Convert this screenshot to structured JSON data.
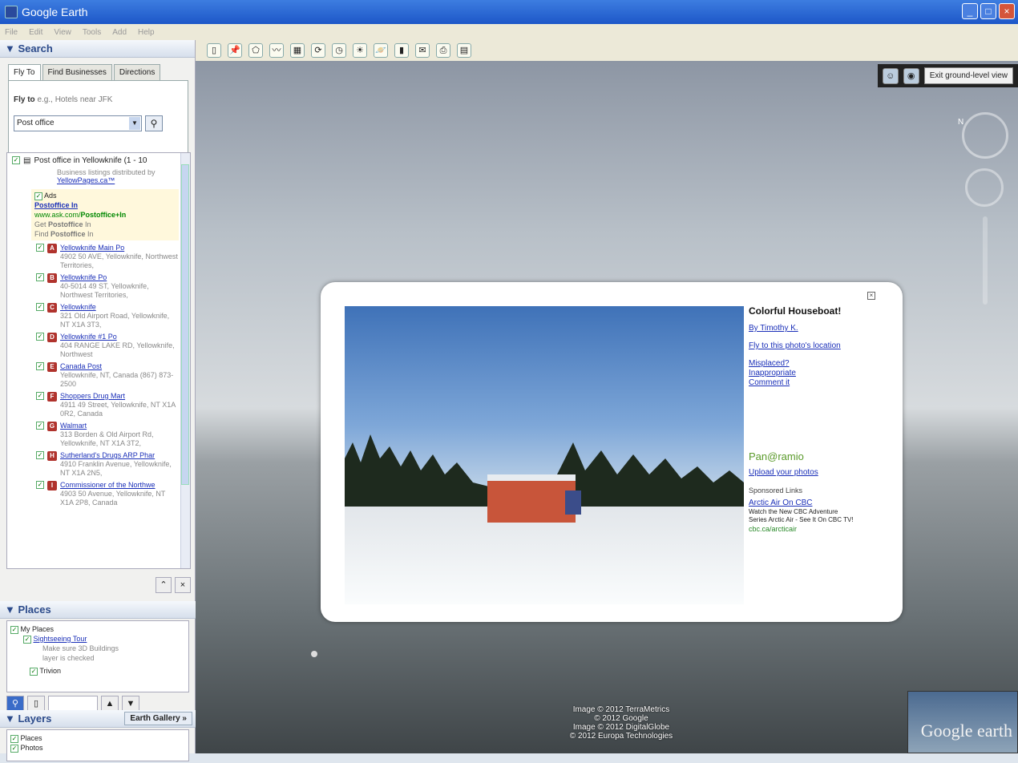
{
  "window": {
    "title": "Google Earth"
  },
  "menu": [
    "File",
    "Edit",
    "View",
    "Tools",
    "Add",
    "Help"
  ],
  "search": {
    "panel_title": "▼ Search",
    "tabs": [
      "Fly To",
      "Find Businesses",
      "Directions"
    ],
    "flyto_label": "Fly to",
    "flyto_hint": "e.g., Hotels near JFK",
    "input_value": "Post office"
  },
  "results": {
    "header": "Post office in Yellowknife (1 - 10",
    "subheader": "Business listings distributed by",
    "provider": "YellowPages.ca™",
    "ads": {
      "label": "Ads",
      "title": "Postoffice In",
      "url_prefix": "www.ask.com/",
      "url_bold": "Postoffice+In",
      "line1_prefix": "Get ",
      "line1_bold": "Postoffice",
      "line1_suffix": " In",
      "line2_prefix": "Find ",
      "line2_bold": "Postoffice",
      "line2_suffix": " In"
    },
    "items": [
      {
        "mark": "A",
        "name": "Yellowknife Main Po",
        "addr": "4902 50 AVE, Yellowknife, Northwest Territories,"
      },
      {
        "mark": "B",
        "name": "Yellowknife Po",
        "addr": "40-5014 49 ST, Yellowknife, Northwest Territories,"
      },
      {
        "mark": "C",
        "name": "Yellowknife",
        "addr": "321 Old Airport Road, Yellowknife, NT X1A 3T3,"
      },
      {
        "mark": "D",
        "name": "Yellowknife #1 Po",
        "addr": "404 RANGE LAKE RD, Yellowknife, Northwest"
      },
      {
        "mark": "E",
        "name": "Canada Post",
        "addr": "Yellowknife, NT, Canada (867) 873-2500"
      },
      {
        "mark": "F",
        "name": "Shoppers Drug Mart",
        "addr": "4911 49 Street, Yellowknife, NT X1A 0R2, Canada"
      },
      {
        "mark": "G",
        "name": "Walmart",
        "addr": "313 Borden & Old Airport Rd, Yellowknife, NT X1A 3T2,"
      },
      {
        "mark": "H",
        "name": "Sutherland's Drugs ARP Phar",
        "addr": "4910 Franklin Avenue, Yellowknife, NT X1A 2N5,"
      },
      {
        "mark": "I",
        "name": "Commissioner of the Northwe",
        "addr": "4903 50 Avenue, Yellowknife, NT X1A 2P8, Canada"
      }
    ]
  },
  "places": {
    "panel_title": "▼ Places",
    "my_places": "My Places",
    "tour": "Sightseeing Tour",
    "tour_note1": "Make sure 3D Buildings",
    "tour_note2": "layer is checked",
    "temp": "Trivion"
  },
  "layers": {
    "panel_title": "▼ Layers",
    "gallery": "Earth Gallery »",
    "item1": "Places",
    "item2": "Photos"
  },
  "view": {
    "exit_label": "Exit ground-level view",
    "nav_letter": "N"
  },
  "popup": {
    "title": "Colorful Houseboat!",
    "author": "By Timothy K.",
    "flyto": "Fly to this photo's location",
    "misplaced": "Misplaced?",
    "inappropriate": "Inappropriate",
    "comment": "Comment it",
    "panoramio": "Pan@ramio",
    "upload": "Upload your photos",
    "sponsored": "Sponsored Links",
    "ad_title": "Arctic Air On CBC",
    "ad_line1": "Watch the New CBC Adventure",
    "ad_line2": "Series Arctic Air - See It On CBC TV!",
    "ad_url": "cbc.ca/arcticair"
  },
  "credits": [
    "Image © 2012 TerraMetrics",
    "© 2012 Google",
    "Image © 2012 DigitalGlobe",
    "© 2012 Europa Technologies"
  ],
  "logo": "Google earth"
}
